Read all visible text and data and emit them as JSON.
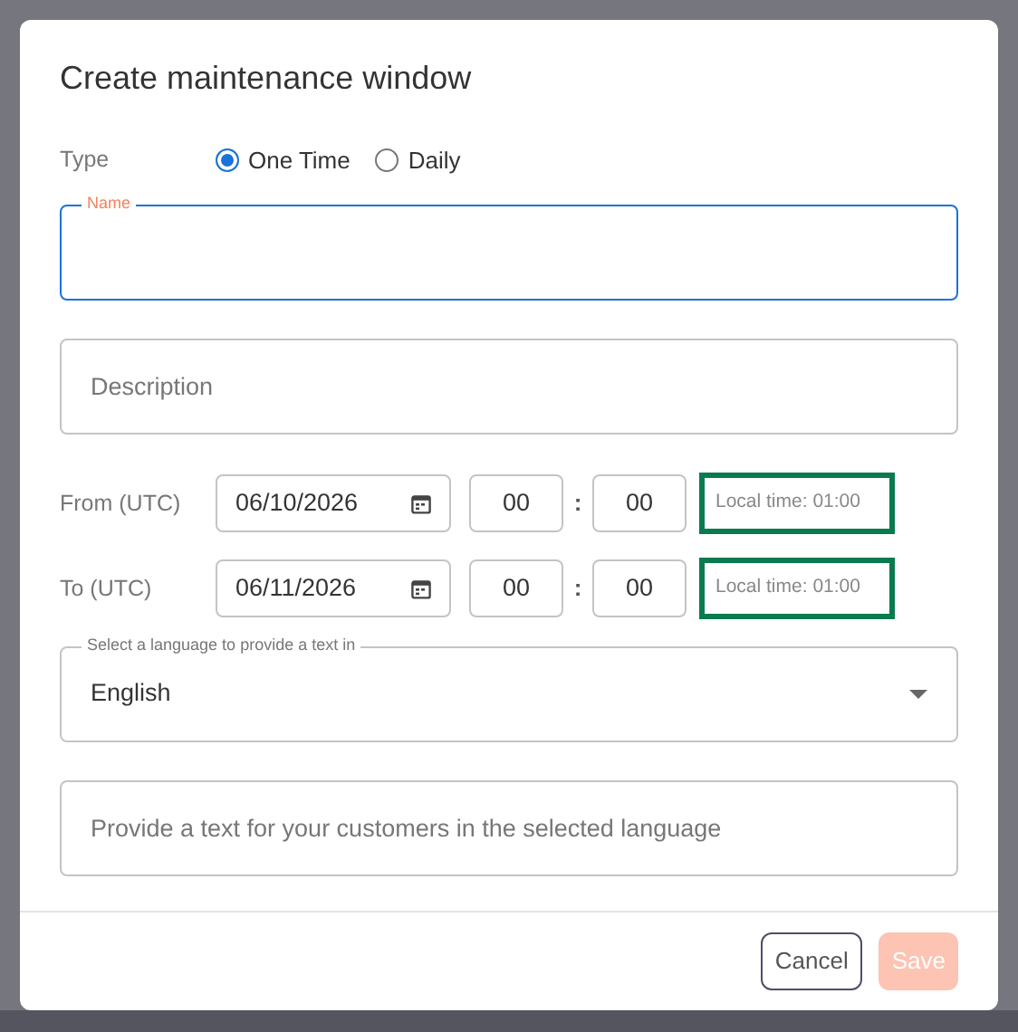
{
  "dialog": {
    "title": "Create maintenance window"
  },
  "type_field": {
    "label": "Type",
    "options": [
      {
        "label": "One Time",
        "selected": true
      },
      {
        "label": "Daily",
        "selected": false
      }
    ]
  },
  "name_field": {
    "label": "Name",
    "focused": true
  },
  "description_field": {
    "placeholder": "Description"
  },
  "time_rows": [
    {
      "label": "From (UTC)",
      "date": "06/10/2026",
      "hour": "00",
      "separator": ":",
      "minute": "00",
      "local_time": "Local time: 01:00",
      "highlighted": true
    },
    {
      "label": "To (UTC)",
      "date": "06/11/2026",
      "hour": "00",
      "separator": ":",
      "minute": "00",
      "local_time": "Local time: 01:00",
      "highlighted": true
    }
  ],
  "language_select": {
    "label": "Select a language to provide a text in",
    "value": "English"
  },
  "text_field": {
    "placeholder": "Provide a text for your customers in the selected language"
  },
  "buttons": [
    {
      "label": "Cancel",
      "kind": "secondary",
      "disabled": false
    },
    {
      "label": "Save",
      "kind": "primary",
      "disabled": true
    }
  ]
}
